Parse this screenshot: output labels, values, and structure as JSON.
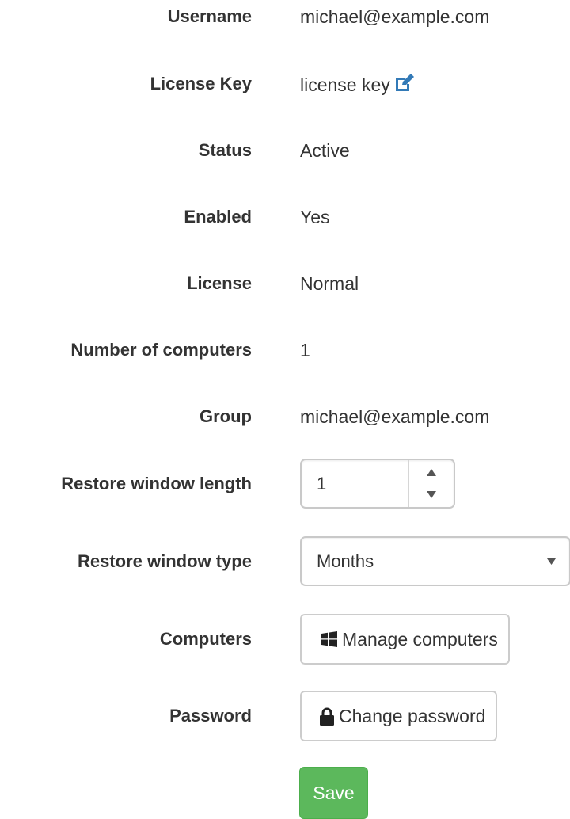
{
  "fields": [
    {
      "label": "Username",
      "value": "michael@example.com"
    },
    {
      "label": "License Key",
      "value": "license key",
      "icon": "edit-icon"
    },
    {
      "label": "Status",
      "value": "Active"
    },
    {
      "label": "Enabled",
      "value": "Yes"
    },
    {
      "label": "License",
      "value": "Normal"
    },
    {
      "label": "Number of computers",
      "value": "1"
    },
    {
      "label": "Group",
      "value": "michael@example.com"
    }
  ],
  "restore_window_length": {
    "label": "Restore window length",
    "value": "1"
  },
  "restore_window_type": {
    "label": "Restore window type",
    "value": "Months"
  },
  "computers": {
    "label": "Computers",
    "button_label": "Manage computers",
    "icon": "windows-icon"
  },
  "password": {
    "label": "Password",
    "button_label": "Change password",
    "icon": "lock-icon"
  },
  "save": {
    "label": "Save"
  },
  "colors": {
    "link": "#337ab7",
    "success": "#5cb85c",
    "text": "#333333"
  }
}
